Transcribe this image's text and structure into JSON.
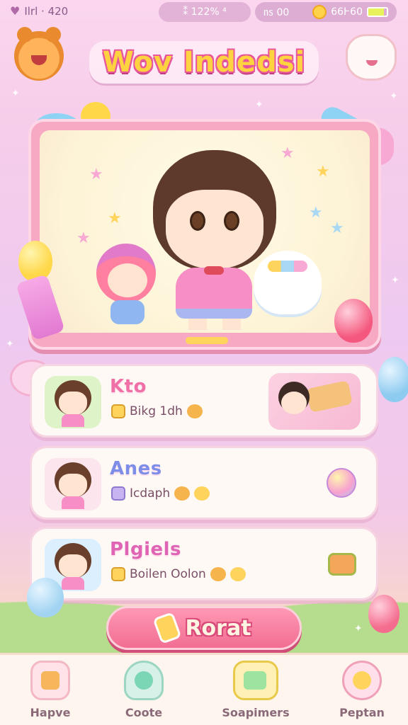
{
  "status_bar": {
    "signal_text": "Ilrl · 420",
    "center_text": "⁑ 122% ⁴",
    "right_text": "㎱ 00",
    "coins": "66Ͱ60",
    "battery_level": 0.85
  },
  "header": {
    "title": "Wov Indedsi",
    "left_mascot_icon": "bear-mascot-icon",
    "right_mascot_icon": "bunny-mascot-icon"
  },
  "stage": {
    "main_character_icon": "brown-haired-kid-character",
    "left_companion_icon": "pink-haired-girl-character",
    "right_companion_icon": "cloud-pet-character"
  },
  "cards": [
    {
      "name": "Kto",
      "subtitle": "Bikg 1dh",
      "avatar_color": "#dff3c8",
      "right_icon": "plank-thumbnail-icon"
    },
    {
      "name": "Anes",
      "subtitle": "Icdaph",
      "avatar_color": "#fde5ee",
      "right_icon": "balloon-icon"
    },
    {
      "name": "Plgiels",
      "subtitle": "Boilen Oolon",
      "avatar_color": "#dcefff",
      "right_icon": "tag-icon"
    }
  ],
  "action": {
    "label": "Rorat",
    "icon": "popsicle-icon"
  },
  "nav": {
    "items": [
      {
        "label": "Hapve",
        "icon": "cake-icon"
      },
      {
        "label": "Coote",
        "icon": "bell-icon"
      },
      {
        "label": "Soapimers",
        "icon": "monitor-icon"
      },
      {
        "label": "Peptan",
        "icon": "lollipop-icon"
      }
    ]
  },
  "colors": {
    "accent_pink": "#f06fa6",
    "title_yellow": "#ffd23f",
    "button_pink": "#f16e92"
  }
}
